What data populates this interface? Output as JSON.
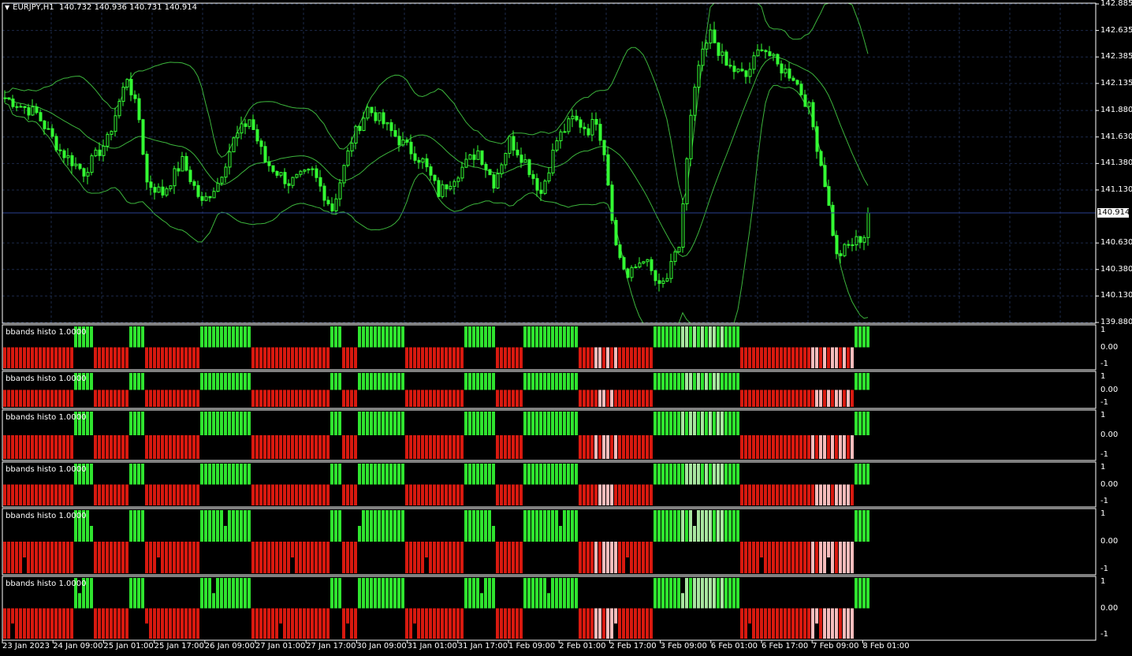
{
  "header": {
    "symbol_tf": "EURJPY,H1",
    "ohlc": "140.732 140.936 140.731 140.914"
  },
  "price_axis": {
    "labels": [
      "142.885",
      "142.635",
      "142.385",
      "142.135",
      "141.880",
      "141.630",
      "141.380",
      "141.130",
      "140.914",
      "140.630",
      "140.380",
      "140.130",
      "139.880"
    ],
    "current": "140.914"
  },
  "time_axis": {
    "labels": [
      "23 Jan 2023",
      "24 Jan 09:00",
      "25 Jan 01:00",
      "25 Jan 17:00",
      "26 Jan 09:00",
      "27 Jan 01:00",
      "27 Jan 17:00",
      "30 Jan 09:00",
      "31 Jan 01:00",
      "31 Jan 17:00",
      "1 Feb 09:00",
      "2 Feb 01:00",
      "2 Feb 17:00",
      "3 Feb 09:00",
      "6 Feb 01:00",
      "6 Feb 17:00",
      "7 Feb 09:00",
      "8 Feb 01:00"
    ]
  },
  "indicator_panes": [
    {
      "title": "bbands histo 1.0000",
      "levels": [
        "1",
        "0.00",
        "-1"
      ]
    },
    {
      "title": "bbands histo 1.0000",
      "levels": [
        "1",
        "0.00",
        "-1"
      ]
    },
    {
      "title": "bbands histo 1.0000",
      "levels": [
        "1",
        "0.00",
        "-1"
      ]
    },
    {
      "title": "bbands histo 1.0000",
      "levels": [
        "1",
        "0.00",
        "-1"
      ]
    },
    {
      "title": "bbands histo 1.0000",
      "levels": [
        "1",
        "0.00",
        "-1"
      ]
    },
    {
      "title": "bbands histo 1.0000",
      "levels": [
        "1",
        "0.00",
        "-1"
      ]
    }
  ],
  "colors": {
    "background": "#000000",
    "grid": "#1c2a4a",
    "candle": "#33ff33",
    "band": "#3cb43c",
    "hist_up": "#2fe42f",
    "hist_up_weak": "#a8e6a0",
    "hist_down": "#d8190f",
    "hist_down_weak": "#f6bcbc",
    "border": "#ffffff"
  },
  "chart_data": {
    "type": "candlestick",
    "symbol": "EURJPY",
    "timeframe": "H1",
    "y_range": [
      139.88,
      142.885
    ],
    "last_price": 140.914,
    "approx_close_path": [
      {
        "t": "23 Jan 2023",
        "close": 142.0
      },
      {
        "t": "24 Jan 09:00",
        "close": 141.4
      },
      {
        "t": "25 Jan 01:00",
        "close": 142.2
      },
      {
        "t": "25 Jan 17:00",
        "close": 141.05
      },
      {
        "t": "26 Jan 09:00",
        "close": 141.6
      },
      {
        "t": "27 Jan 01:00",
        "close": 141.3
      },
      {
        "t": "27 Jan 17:00",
        "close": 141.0
      },
      {
        "t": "30 Jan 09:00",
        "close": 141.9
      },
      {
        "t": "31 Jan 01:00",
        "close": 141.2
      },
      {
        "t": "31 Jan 17:00",
        "close": 141.5
      },
      {
        "t": "1 Feb 09:00",
        "close": 141.4
      },
      {
        "t": "2 Feb 01:00",
        "close": 141.8
      },
      {
        "t": "2 Feb 17:00",
        "close": 140.3
      },
      {
        "t": "3 Feb 09:00",
        "close": 140.6
      },
      {
        "t": "6 Feb 01:00",
        "close": 142.6
      },
      {
        "t": "6 Feb 17:00",
        "close": 142.3
      },
      {
        "t": "7 Feb 09:00",
        "close": 141.2
      },
      {
        "t": "8 Feb 01:00",
        "close": 140.914
      }
    ]
  }
}
